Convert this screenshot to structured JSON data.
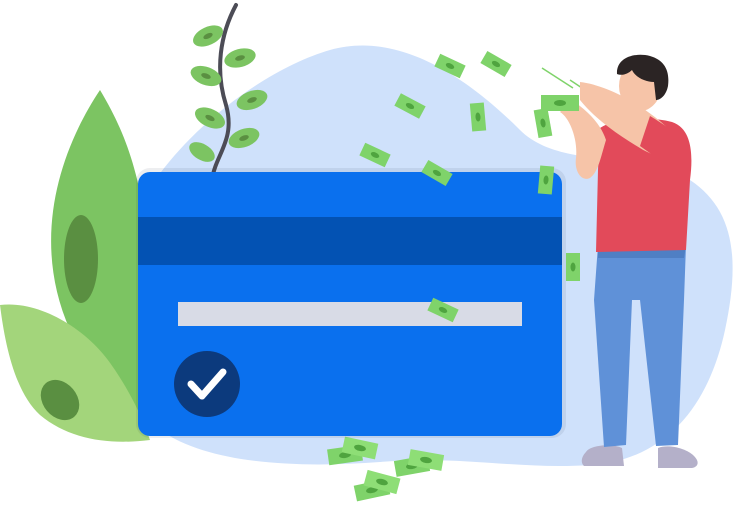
{
  "illustration": {
    "subject": "credit-card-payment",
    "icons": {
      "card": "credit-card-icon",
      "check": "checkmark-icon",
      "money": "banknote-icon",
      "plant_left": "leaf-plant-icon",
      "plant_top": "vine-plant-icon",
      "person": "person-icon"
    }
  },
  "colors": {
    "background": "#ffffff",
    "blob": "#cfe1fb",
    "card_body": "#0a70ee",
    "card_stripe": "#0352b3",
    "card_bar": "#d8dbe6",
    "check_circle": "#0c3a7d",
    "leaf_light": "#a3d57b",
    "leaf_dark": "#7cc462",
    "leaf_spot": "#5a8f41",
    "bill": "#7fd36a",
    "bill_mark": "#4fa43f",
    "shirt": "#e24a5a",
    "jeans": "#5f91d8",
    "skin": "#f6c4a8",
    "hair": "#2b2424",
    "shoe": "#b4b0c9"
  }
}
